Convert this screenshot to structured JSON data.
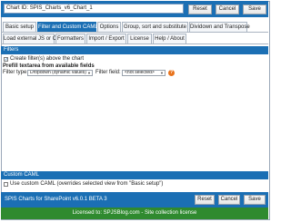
{
  "header": {
    "chart_id_label": "Chart ID:",
    "chart_id_value": "SPIS_Charts_v6_Chart_1",
    "reset_label": "Reset",
    "cancel_label": "Cancel",
    "save_label": "Save"
  },
  "tabs": {
    "row1": [
      {
        "label": "Basic setup",
        "active": false
      },
      {
        "label": "Filter and Custom CAML",
        "active": true
      },
      {
        "label": "Options",
        "active": false
      },
      {
        "label": "Group, sort and substitute",
        "active": false
      },
      {
        "label": "Dividown and Transpose",
        "active": false
      }
    ],
    "row2": [
      {
        "label": "Load external JS or CSS",
        "active": false
      },
      {
        "label": "Formatters",
        "active": false
      },
      {
        "label": "Import / Export",
        "active": false
      },
      {
        "label": "License",
        "active": false
      },
      {
        "label": "Help / About",
        "active": false
      }
    ]
  },
  "filters": {
    "section_title": "Filters",
    "create_filters_label": "Create filter(s) above the chart",
    "create_filters_checked": true,
    "prefill_title": "Prefill textarea from available fields",
    "filter_type_label": "Filter type:",
    "filter_type_value": "Dropdown (dynamic values)",
    "filter_field_label": "Filter field:",
    "filter_field_value": "<not selected>",
    "help_glyph": "?"
  },
  "custom_caml": {
    "section_title": "Custom CAML",
    "use_custom_label": "Use custom CAML (overrides selected view from \"Basic setup\")",
    "use_custom_checked": false
  },
  "footer": {
    "product_label": "SPIS Charts for SharePoint v6.0.1 BETA 3",
    "reset_label": "Reset",
    "cancel_label": "Cancel",
    "save_label": "Save",
    "license_text": "Licensed to: SPJSBlog.com - Site collection license"
  },
  "colors": {
    "accent": "#1b6fb4",
    "license_green": "#2f8a2f",
    "help_orange": "#e8731c"
  }
}
